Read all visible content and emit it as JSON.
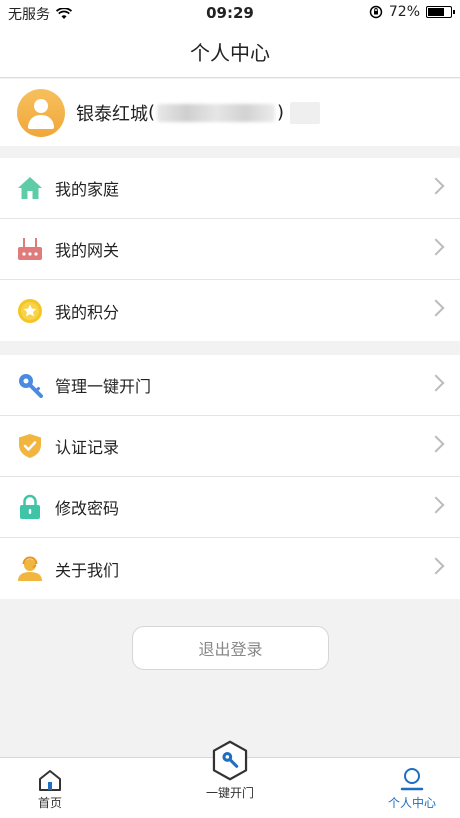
{
  "status_bar": {
    "carrier": "无服务",
    "time": "09:29",
    "battery": "72%",
    "battery_level": 0.72
  },
  "nav": {
    "title": "个人中心"
  },
  "profile": {
    "name": "银泰红城",
    "open_paren": "(",
    "close_paren": ")"
  },
  "menu_group_1": [
    {
      "label": "我的家庭",
      "icon": "house-icon",
      "color": "#5fcca8"
    },
    {
      "label": "我的网关",
      "icon": "router-icon",
      "color": "#e07b7b"
    },
    {
      "label": "我的积分",
      "icon": "star-coin-icon",
      "color": "#f5c623"
    }
  ],
  "menu_group_2": [
    {
      "label": "管理一键开门",
      "icon": "key-icon",
      "color": "#4a8be0"
    },
    {
      "label": "认证记录",
      "icon": "shield-check-icon",
      "color": "#f0b640"
    },
    {
      "label": "修改密码",
      "icon": "lock-icon",
      "color": "#3fc4a8"
    },
    {
      "label": "关于我们",
      "icon": "support-agent-icon",
      "color": "#f0b640"
    }
  ],
  "logout": {
    "label": "退出登录"
  },
  "tabs": [
    {
      "label": "首页",
      "icon": "home-icon"
    },
    {
      "label": "一键开门",
      "icon": "hex-key-icon"
    },
    {
      "label": "个人中心",
      "icon": "person-icon"
    }
  ],
  "colors": {
    "accent": "#1e6fc0",
    "background": "#f2f2f2"
  }
}
